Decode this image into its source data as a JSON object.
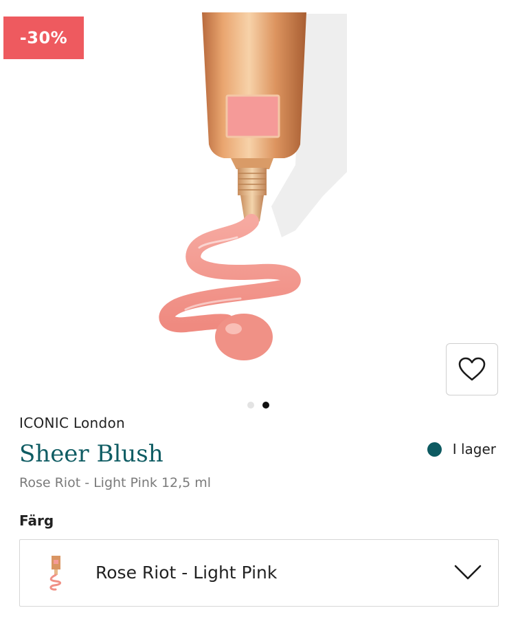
{
  "badge": {
    "discount": "-30%"
  },
  "product": {
    "brand": "ICONIC London",
    "name": "Sheer Blush",
    "variant": "Rose Riot - Light Pink 12,5 ml",
    "stock": "I lager"
  },
  "carousel": {
    "total": 2,
    "active": 2
  },
  "color": {
    "label": "Färg",
    "selected": "Rose Riot - Light Pink"
  },
  "icons": {
    "wishlist": "heart-icon",
    "dropdown": "chevron-down-icon",
    "stock": "dot-icon"
  },
  "colors": {
    "badge": "#ee5a5f",
    "product_name": "#0f5c63",
    "stock_dot": "#0d5a61",
    "blush": "#f2948c"
  }
}
